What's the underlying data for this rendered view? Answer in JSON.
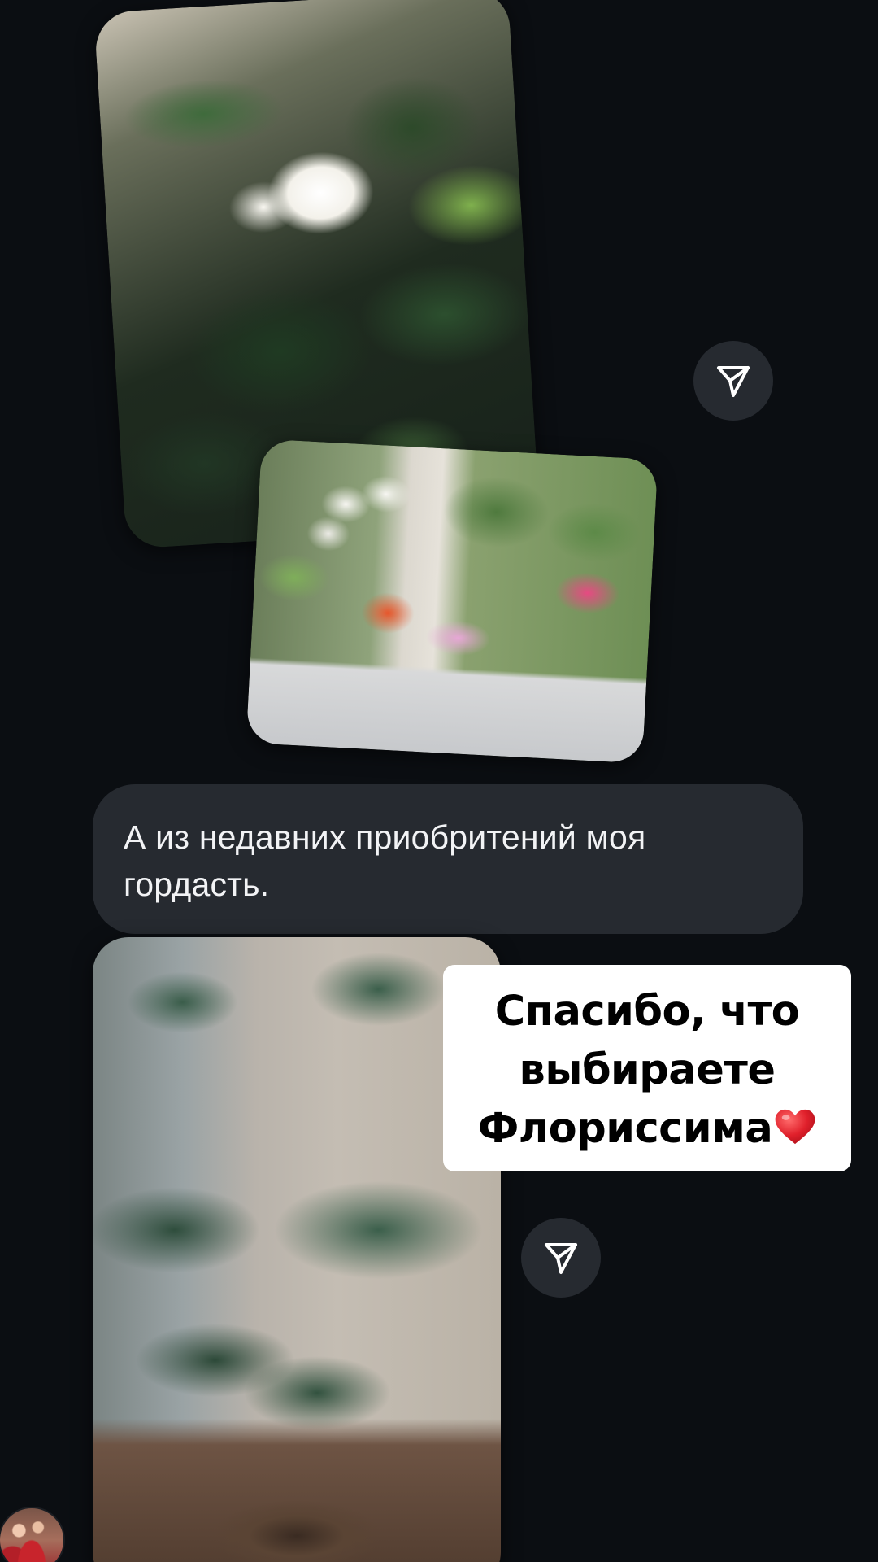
{
  "message": {
    "text": "А из недавних приобритений моя гордасть."
  },
  "sticker": {
    "line1": "Спасибо, что",
    "line2": "выбираете",
    "line3": "Флориссима"
  },
  "icons": {
    "share": "share-paper-plane-icon",
    "heart": "red-heart-emoji"
  },
  "colors": {
    "background": "#0b0e12",
    "bubble": "#262a30",
    "bubble_text": "#f2f3f5",
    "sticker_bg": "#ffffff",
    "heart": "#e0202b"
  }
}
